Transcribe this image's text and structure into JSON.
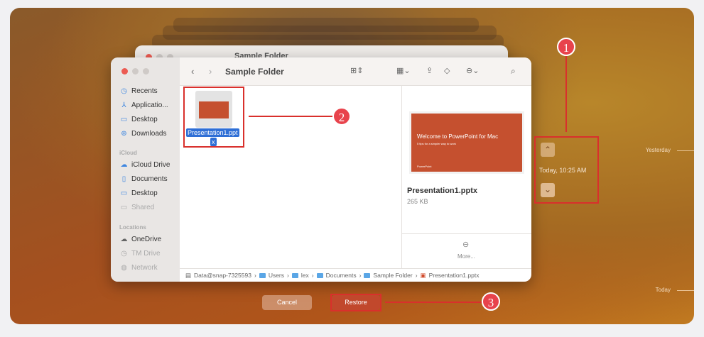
{
  "finder": {
    "title": "Sample Folder",
    "back_title": "Sample Folder",
    "sidebar": {
      "favorites": [
        {
          "label": "Recents",
          "icon": "clock-icon"
        },
        {
          "label": "Applicatio...",
          "icon": "apps-icon"
        },
        {
          "label": "Desktop",
          "icon": "desktop-icon"
        },
        {
          "label": "Downloads",
          "icon": "download-icon"
        }
      ],
      "icloud_heading": "iCloud",
      "icloud": [
        {
          "label": "iCloud Drive",
          "icon": "cloud-icon"
        },
        {
          "label": "Documents",
          "icon": "document-icon"
        },
        {
          "label": "Desktop",
          "icon": "desktop-icon"
        },
        {
          "label": "Shared",
          "icon": "shared-icon"
        }
      ],
      "locations_heading": "Locations",
      "locations": [
        {
          "label": "OneDrive",
          "icon": "cloud-icon"
        },
        {
          "label": "TM Drive",
          "icon": "clock-icon"
        },
        {
          "label": "Network",
          "icon": "globe-icon"
        }
      ]
    },
    "file": {
      "name_line1": "Presentation1.ppt",
      "name_line2": "x"
    },
    "preview": {
      "slide_title": "Welcome to PowerPoint for Mac",
      "slide_subtitle": "5 tips for a simpler way to work",
      "slide_brand": "PowerPoint",
      "name": "Presentation1.pptx",
      "size": "265 KB",
      "more": "More..."
    },
    "path": [
      "Data@snap-7325593",
      "Users",
      "lex",
      "Documents",
      "Sample Folder",
      "Presentation1.pptx"
    ]
  },
  "buttons": {
    "cancel": "Cancel",
    "restore": "Restore"
  },
  "timemachine": {
    "current": "Today, 10:25 AM",
    "yesterday": "Yesterday",
    "today": "Today"
  },
  "annotations": [
    "1",
    "2",
    "3"
  ],
  "colors": {
    "accent": "#d9302c",
    "badge": "#e8434c",
    "selection": "#2f6fd6"
  }
}
